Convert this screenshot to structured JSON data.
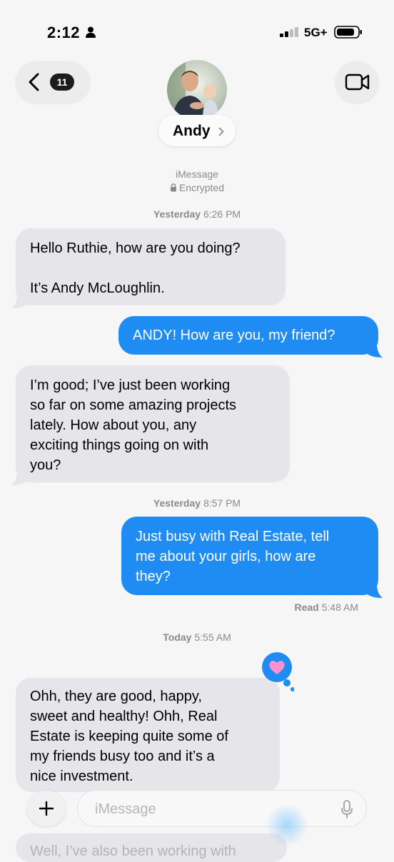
{
  "status_bar": {
    "time": "2:12",
    "network": "5G+"
  },
  "header": {
    "back_badge": "11",
    "contact_name": "Andy"
  },
  "conversation_info": {
    "service": "iMessage",
    "encryption": "Encrypted"
  },
  "timestamps": [
    {
      "day": "Yesterday",
      "time": "6:26 PM"
    },
    {
      "day": "Yesterday",
      "time": "8:57 PM"
    },
    {
      "day": "Today",
      "time": "5:55 AM"
    }
  ],
  "messages": [
    {
      "direction": "incoming",
      "lines": [
        "Hello Ruthie, how are you doing?",
        "",
        "It’s Andy McLoughlin."
      ]
    },
    {
      "direction": "outgoing",
      "lines": [
        "ANDY! How are you, my friend?"
      ]
    },
    {
      "direction": "incoming",
      "lines": [
        "I’m good; I’ve just been working",
        "so far on some amazing projects",
        "lately. How about you, any",
        "exciting things going on with",
        "you?"
      ]
    },
    {
      "direction": "outgoing",
      "lines": [
        "Just busy with Real Estate, tell",
        "me about your girls, how are",
        "they?"
      ]
    },
    {
      "direction": "incoming",
      "lines": [
        "Ohh, they are good, happy,",
        "sweet and healthy! Ohh, Real",
        "Estate is keeping quite some of",
        "my friends busy too and it’s a",
        "nice investment."
      ]
    },
    {
      "direction": "incoming",
      "lines": [
        "Well, I’ve also been working with"
      ]
    }
  ],
  "read_receipt": {
    "label": "Read",
    "time": "5:48 AM"
  },
  "tapback": {
    "icon": "heart-icon",
    "color": "#ff8fd0"
  },
  "input_bar": {
    "placeholder": "iMessage"
  },
  "colors": {
    "outgoing_bubble": "#1e8cf3",
    "incoming_bubble": "#e5e5ea",
    "background": "#f6f6f6"
  }
}
